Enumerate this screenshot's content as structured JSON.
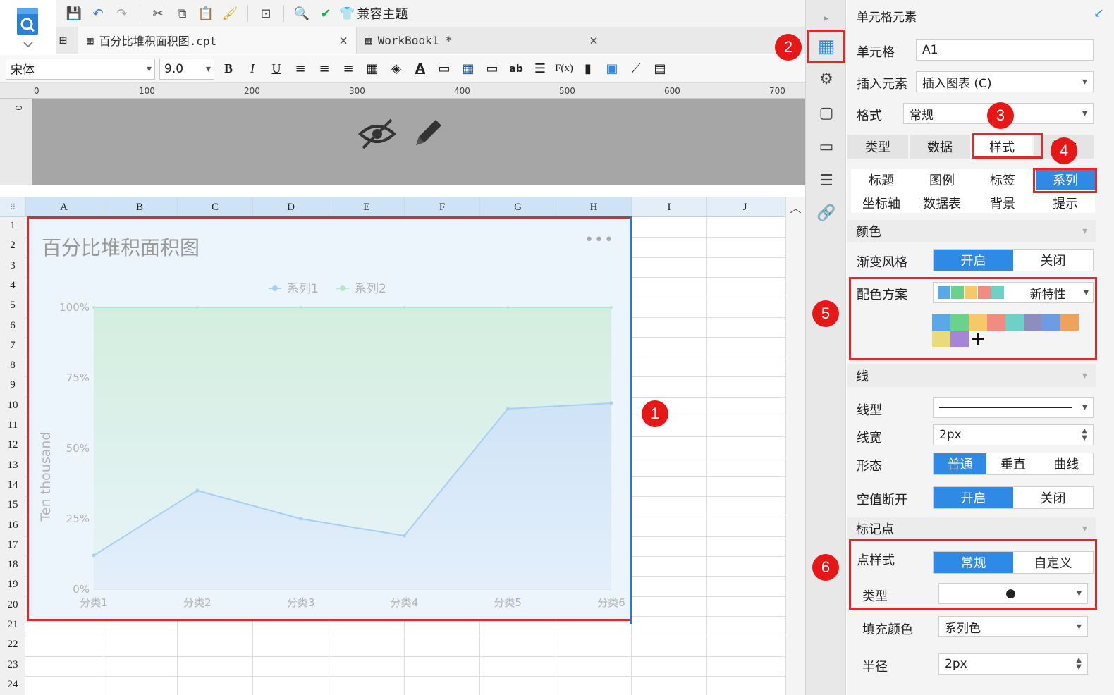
{
  "toolbar": {
    "theme_label": "兼容主题",
    "font_name": "宋体",
    "font_size": "9.0"
  },
  "tabs": [
    {
      "label": "百分比堆积面积图.cpt",
      "close": "×"
    },
    {
      "label": "WorkBook1 *",
      "close": "×"
    }
  ],
  "ruler": {
    "ticks": [
      "0",
      "100",
      "200",
      "300",
      "400",
      "500",
      "600",
      "700"
    ],
    "vertical_tick": "0"
  },
  "grid": {
    "columns": [
      "A",
      "B",
      "C",
      "D",
      "E",
      "F",
      "G",
      "H",
      "I",
      "J"
    ],
    "rows": [
      "1",
      "2",
      "3",
      "4",
      "5",
      "6",
      "7",
      "8",
      "9",
      "10",
      "11",
      "12",
      "13",
      "14",
      "15",
      "16",
      "17",
      "18",
      "19",
      "20",
      "21",
      "22",
      "23",
      "24"
    ]
  },
  "chart": {
    "more": "•••"
  },
  "chart_data": {
    "type": "area",
    "title": "百分比堆积面积图",
    "ylabel": "Ten thousand",
    "xlabel": "",
    "categories": [
      "分类1",
      "分类2",
      "分类3",
      "分类4",
      "分类5",
      "分类6"
    ],
    "yticks": [
      "0%",
      "25%",
      "50%",
      "75%",
      "100%"
    ],
    "ylim": [
      0,
      100
    ],
    "stacked": "percent",
    "legend_position": "top",
    "series": [
      {
        "name": "系列1",
        "values": [
          12,
          35,
          25,
          19,
          64,
          66
        ],
        "color": "#a7d0f2"
      },
      {
        "name": "系列2",
        "values": [
          88,
          65,
          75,
          81,
          36,
          34
        ],
        "color": "#b7e6cf"
      }
    ]
  },
  "panel": {
    "title": "单元格元素",
    "cell_label": "单元格",
    "cell_value": "A1",
    "insert_label": "插入元素",
    "insert_value": "插入图表 (C)",
    "format_label": "格式",
    "format_value": "常规",
    "tabs": [
      "类型",
      "数据",
      "样式",
      "特效"
    ],
    "subtabs_row1": [
      "标题",
      "图例",
      "标签",
      "系列"
    ],
    "subtabs_row2": [
      "坐标轴",
      "数据表",
      "背景",
      "提示"
    ],
    "color_section": "颜色",
    "gradient_label": "渐变风格",
    "on": "开启",
    "off": "关闭",
    "scheme_label": "配色方案",
    "scheme_value": "新特性",
    "scheme_preview": [
      "#5ba8e8",
      "#6ad28a",
      "#f6c86a",
      "#f28b82",
      "#6ed1c6"
    ],
    "palette": [
      "#5ba8e8",
      "#6ad28a",
      "#f6c86a",
      "#f28b82",
      "#6ed1c6",
      "#8d8dbe",
      "#6d9be4",
      "#f0a25a",
      "#eadb7a",
      "#a586d6"
    ],
    "add": "+",
    "line_section": "线",
    "line_type_label": "线型",
    "line_width_label": "线宽",
    "line_width_value": "2px",
    "shape_label": "形态",
    "shape_options": [
      "普通",
      "垂直",
      "曲线"
    ],
    "null_break_label": "空值断开",
    "marker_section": "标记点",
    "point_style_label": "点样式",
    "point_style_options": [
      "常规",
      "自定义"
    ],
    "type_label": "类型",
    "type_value": "●",
    "fill_label": "填充颜色",
    "fill_value": "系列色",
    "radius_label": "半径",
    "radius_value": "2px"
  },
  "badges": [
    "1",
    "2",
    "3",
    "4",
    "5",
    "6"
  ]
}
